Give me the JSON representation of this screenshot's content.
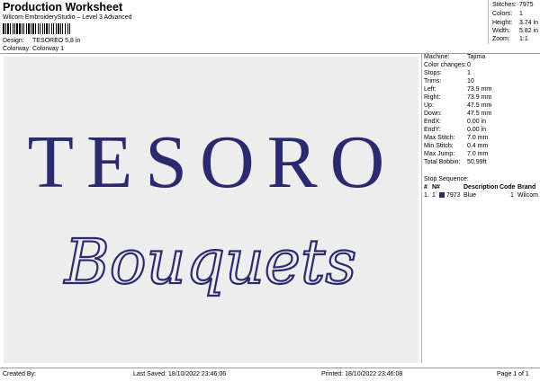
{
  "header": {
    "title": "Production Worksheet",
    "software": "Wilcom EmbroideryStudio – Level 3 Advanced",
    "design_label": "Design:",
    "design_value": "TESOREO 5,8 in",
    "colorway_label": "Colorway:",
    "colorway_value": "Colorway 1"
  },
  "header_stats": [
    {
      "label": "Stitches:",
      "value": "7975"
    },
    {
      "label": "Colors:",
      "value": "1"
    },
    {
      "label": "Height:",
      "value": "3.74 in"
    },
    {
      "label": "Width:",
      "value": "5.82 in"
    },
    {
      "label": "Zoom:",
      "value": "1:1"
    }
  ],
  "preview": {
    "line1": "TESORO",
    "line2": "Bouquets",
    "thread_color": "#2b2a6e",
    "background": "#ededed"
  },
  "stats": [
    {
      "label": "Machine:",
      "value": "Tajima"
    },
    {
      "label": "Color changes:",
      "value": "0"
    },
    {
      "label": "Stops:",
      "value": "1"
    },
    {
      "label": "Trims:",
      "value": "10"
    },
    {
      "label": "Left:",
      "value": "73.9 mm"
    },
    {
      "label": "Right:",
      "value": "73.9 mm"
    },
    {
      "label": "Up:",
      "value": "47.5 mm"
    },
    {
      "label": "Down:",
      "value": "47.5 mm"
    },
    {
      "label": "EndX:",
      "value": "0.00 in"
    },
    {
      "label": "EndY:",
      "value": "0.00 in"
    },
    {
      "label": "Max Stitch:",
      "value": "7.0 mm"
    },
    {
      "label": "Min Stitch:",
      "value": "0.4 mm"
    },
    {
      "label": "Max Jump:",
      "value": "7.0 mm"
    },
    {
      "label": "Total Bobbin:",
      "value": "50.99ft"
    }
  ],
  "stop_sequence": {
    "heading": "Stop Sequence:",
    "columns": [
      "#",
      "N#",
      "Description",
      "Code",
      "Brand"
    ],
    "rows": [
      {
        "index": "1.",
        "needle": "1",
        "number": "7973",
        "description": "Blue",
        "code": "1",
        "brand": "Wilcom",
        "swatch_color": "#2b2a6e"
      }
    ]
  },
  "footer": {
    "created": "Created By:",
    "last_saved": "Last Saved: 18/10/2022 23:46:06",
    "printed": "Printed: 18/10/2022 23:46:08",
    "page": "Page 1 of 1"
  }
}
